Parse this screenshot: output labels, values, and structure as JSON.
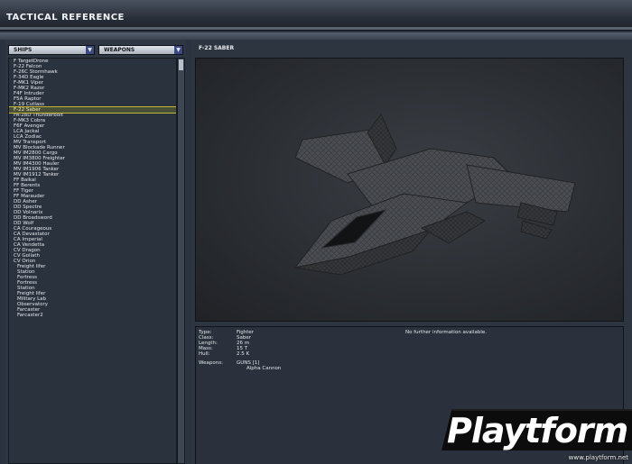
{
  "window": {
    "title": "TACTICAL REFERENCE"
  },
  "filters": {
    "category": {
      "value": "SHIPS"
    },
    "secondary": {
      "value": "WEAPONS"
    }
  },
  "ship_list": {
    "selected_index": 9,
    "items": [
      {
        "label": "F TargetDrone",
        "indent": false
      },
      {
        "label": "F-22 Falcon",
        "indent": false
      },
      {
        "label": "F-26C Stormhawk",
        "indent": false
      },
      {
        "label": "F-34D Eagle",
        "indent": false
      },
      {
        "label": "F-MK1 Viper",
        "indent": false
      },
      {
        "label": "F-MK2 Razor",
        "indent": false
      },
      {
        "label": "F4F Intruder",
        "indent": false
      },
      {
        "label": "F5A Raptor",
        "indent": false
      },
      {
        "label": "F-19 Cutlass",
        "indent": false
      },
      {
        "label": "F-22 Saber",
        "indent": false
      },
      {
        "label": "FA-28D Thunderbolt",
        "indent": false
      },
      {
        "label": "F-MK3 Cobra",
        "indent": false
      },
      {
        "label": "F6F Avenger",
        "indent": false
      },
      {
        "label": "LCA Jackal",
        "indent": false
      },
      {
        "label": "LCA Zodiac",
        "indent": false
      },
      {
        "label": "MV Transport",
        "indent": false
      },
      {
        "label": "MV Blockade Runner",
        "indent": false
      },
      {
        "label": "MV IM2800 Cargo",
        "indent": false
      },
      {
        "label": "MV IM3800 Freighter",
        "indent": false
      },
      {
        "label": "MV IM4300 Hauler",
        "indent": false
      },
      {
        "label": "MV IM1906 Tanker",
        "indent": false
      },
      {
        "label": "MV IM1912 Tanker",
        "indent": false
      },
      {
        "label": "FF Baikal",
        "indent": false
      },
      {
        "label": "FF Berents",
        "indent": false
      },
      {
        "label": "FF Tiger",
        "indent": false
      },
      {
        "label": "FF Marauder",
        "indent": false
      },
      {
        "label": "DD Asher",
        "indent": false
      },
      {
        "label": "DD Spectre",
        "indent": false
      },
      {
        "label": "DD Volnarix",
        "indent": false
      },
      {
        "label": "DD Broadsword",
        "indent": false
      },
      {
        "label": "DD Wolf",
        "indent": false
      },
      {
        "label": "CA Courageous",
        "indent": false
      },
      {
        "label": "CA Devastator",
        "indent": false
      },
      {
        "label": "CA Imperial",
        "indent": false
      },
      {
        "label": "CA Vendetta",
        "indent": false
      },
      {
        "label": "CV Dragon",
        "indent": false
      },
      {
        "label": "CV Goliath",
        "indent": false
      },
      {
        "label": "CV Orion",
        "indent": false
      },
      {
        "label": "Freight lifer",
        "indent": true
      },
      {
        "label": "Station",
        "indent": true
      },
      {
        "label": "Fortress",
        "indent": true
      },
      {
        "label": "Fortress",
        "indent": true
      },
      {
        "label": "Station",
        "indent": true
      },
      {
        "label": "Freight lifer",
        "indent": true
      },
      {
        "label": "Military Lab",
        "indent": true
      },
      {
        "label": "Observatory",
        "indent": true
      },
      {
        "label": "Farcaster",
        "indent": true
      },
      {
        "label": "Farcaster2",
        "indent": true
      }
    ]
  },
  "viewer": {
    "title": "F-22 SABER"
  },
  "details": {
    "fields": [
      {
        "key": "Type:",
        "value": "Fighter"
      },
      {
        "key": "Class:",
        "value": "Saber"
      },
      {
        "key": "Length:",
        "value": "26 m"
      },
      {
        "key": "Mass:",
        "value": "15 T"
      },
      {
        "key": "Hull:",
        "value": "2.5 K"
      }
    ],
    "weapons_label": "Weapons:",
    "weapons_value": "GUNS [1]",
    "weapons_detail": "Alpha Cannon",
    "note": "No further information available."
  },
  "watermark": {
    "logo_text": "Playtform",
    "url": "www.playtform.net"
  },
  "colors": {
    "accent": "#c2b52f",
    "panel": "#2d3541",
    "dropdown_arrow": "#3c4a84"
  }
}
